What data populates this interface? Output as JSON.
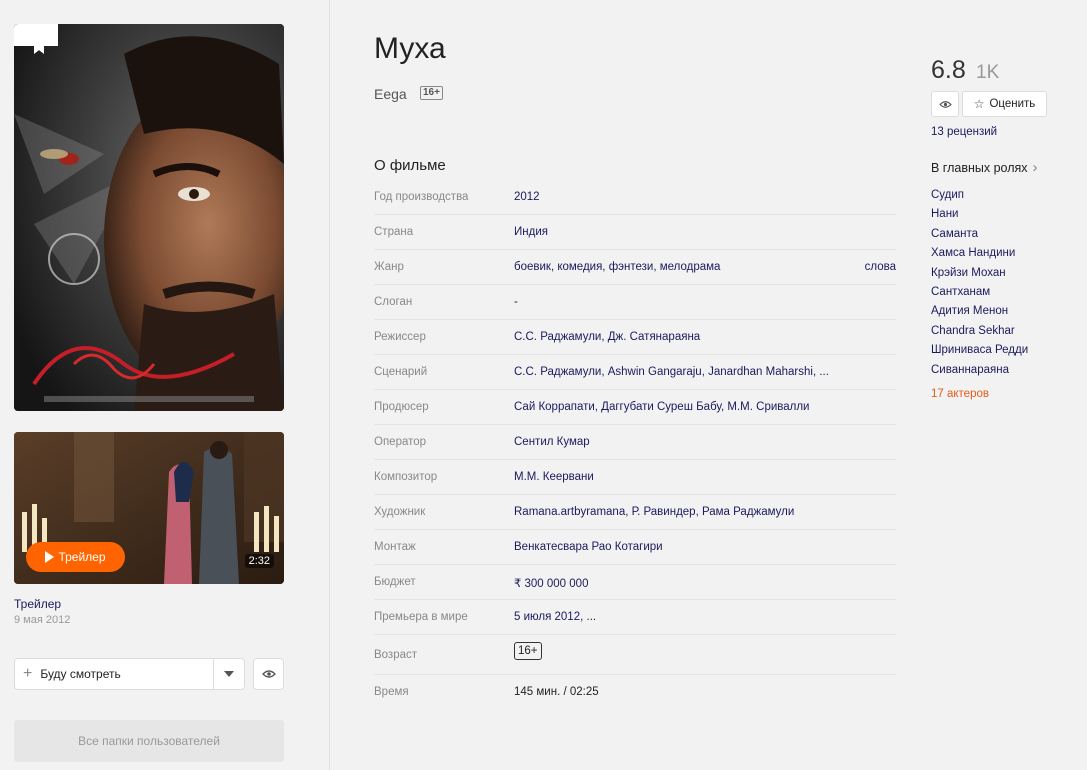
{
  "movie": {
    "title": "Муха",
    "original_title": "Eega",
    "age_rating": "16+"
  },
  "poster": {
    "logo_text": "Eega"
  },
  "trailer": {
    "button_label": "Трейлер",
    "duration": "2:32",
    "title": "Трейлер",
    "date": "9 мая 2012"
  },
  "actions": {
    "watch_later_label": "Буду смотреть",
    "folders_label": "Все папки пользователей",
    "rate_label": "Оценить"
  },
  "about": {
    "heading": "О фильме",
    "rows": [
      {
        "label": "Год производства",
        "value": "2012"
      },
      {
        "label": "Страна",
        "value": "Индия"
      },
      {
        "label": "Жанр",
        "value": "боевик, комедия, фэнтези, мелодрама",
        "extra": "слова"
      },
      {
        "label": "Слоган",
        "value": "-"
      },
      {
        "label": "Режиссер",
        "value": "С.С. Раджамули, Дж. Сатянараяна"
      },
      {
        "label": "Сценарий",
        "value": "С.С. Раджамули, Ashwin Gangaraju, Janardhan Maharshi, ..."
      },
      {
        "label": "Продюсер",
        "value": "Сай Коррапати, Даггубати Суреш Бабу, М.М. Сривалли"
      },
      {
        "label": "Оператор",
        "value": "Сентил Кумар"
      },
      {
        "label": "Композитор",
        "value": "М.М. Кеервани"
      },
      {
        "label": "Художник",
        "value": "Ramana.artbyramana, Р. Равиндер, Рама Раджамули"
      },
      {
        "label": "Монтаж",
        "value": "Венкатесвара Рао Котагири"
      },
      {
        "label": "Бюджет",
        "value": "₹ 300 000 000"
      },
      {
        "label": "Премьера в мире",
        "value": "5 июля 2012, ..."
      },
      {
        "label": "Возраст",
        "value": "16+"
      },
      {
        "label": "Время",
        "value": "145 мин. / 02:25"
      }
    ]
  },
  "rating": {
    "value": "6.8",
    "count": "1K",
    "reviews": "13 рецензий"
  },
  "cast": {
    "heading": "В главных ролях",
    "actors": [
      "Судип",
      "Нани",
      "Саманта",
      "Хамса Нандини",
      "Крэйзи Мохан",
      "Сантханам",
      "Адития Менон",
      "Chandra Sekhar",
      "Шринивaса Редди",
      "Сиваннараяна"
    ],
    "all_link": "17 актеров"
  },
  "colors": {
    "accent": "#ff6400",
    "link": "#1a1a5e",
    "actors_link": "#e65c17"
  }
}
